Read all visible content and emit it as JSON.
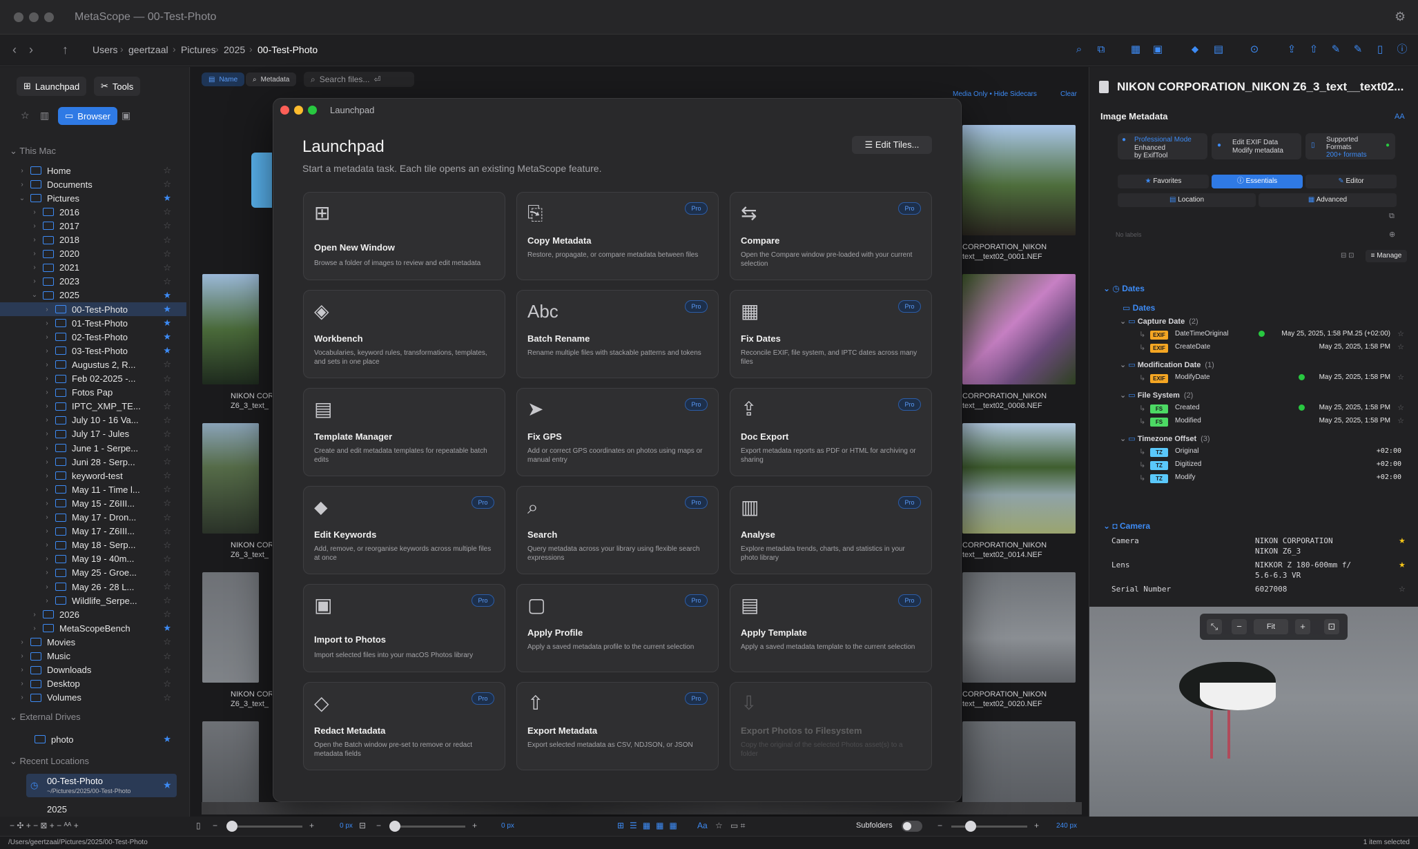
{
  "window": {
    "title": "MetaScope — 00-Test-Photo"
  },
  "breadcrumb": [
    "Users",
    "geertzaal",
    "Pictures",
    "2025",
    "00-Test-Photo"
  ],
  "sidebar": {
    "tabs": [
      "Launchpad",
      "Tools"
    ],
    "browser_label": "Browser",
    "this_mac_label": "This Mac",
    "external_label": "External Drives",
    "recent_label": "Recent Locations",
    "tree": [
      {
        "label": "Home",
        "level": 1,
        "star": false
      },
      {
        "label": "Documents",
        "level": 1,
        "star": false
      },
      {
        "label": "Pictures",
        "level": 1,
        "star": true,
        "open": true
      },
      {
        "label": "2016",
        "level": 2,
        "star": false
      },
      {
        "label": "2017",
        "level": 2,
        "star": false
      },
      {
        "label": "2018",
        "level": 2,
        "star": false
      },
      {
        "label": "2020",
        "level": 2,
        "star": false
      },
      {
        "label": "2021",
        "level": 2,
        "star": false
      },
      {
        "label": "2023",
        "level": 2,
        "star": false
      },
      {
        "label": "2025",
        "level": 2,
        "star": true,
        "open": true
      },
      {
        "label": "00-Test-Photo",
        "level": 3,
        "star": true,
        "selected": true
      },
      {
        "label": "01-Test-Photo",
        "level": 3,
        "star": true
      },
      {
        "label": "02-Test-Photo",
        "level": 3,
        "star": true
      },
      {
        "label": "03-Test-Photo",
        "level": 3,
        "star": true
      },
      {
        "label": "Augustus 2, R...",
        "level": 3,
        "star": false
      },
      {
        "label": "Feb 02-2025 -...",
        "level": 3,
        "star": false
      },
      {
        "label": "Fotos Pap",
        "level": 3,
        "star": false
      },
      {
        "label": "IPTC_XMP_TE...",
        "level": 3,
        "star": false
      },
      {
        "label": "July 10 - 16 Va...",
        "level": 3,
        "star": false
      },
      {
        "label": "July 17 - Jules",
        "level": 3,
        "star": false
      },
      {
        "label": "June 1 - Serpe...",
        "level": 3,
        "star": false
      },
      {
        "label": "Juni 28 - Serp...",
        "level": 3,
        "star": false
      },
      {
        "label": "keyword-test",
        "level": 3,
        "star": false
      },
      {
        "label": "May 11 - Time l...",
        "level": 3,
        "star": false
      },
      {
        "label": "May 15 - Z6III...",
        "level": 3,
        "star": false
      },
      {
        "label": "May 17 - Dron...",
        "level": 3,
        "star": false
      },
      {
        "label": "May 17 - Z6III...",
        "level": 3,
        "star": false
      },
      {
        "label": "May 18 - Serp...",
        "level": 3,
        "star": false
      },
      {
        "label": "May 19 - 40m...",
        "level": 3,
        "star": false
      },
      {
        "label": "May 25 - Groe...",
        "level": 3,
        "star": false
      },
      {
        "label": "May 26 - 28 L...",
        "level": 3,
        "star": false
      },
      {
        "label": "Wildlife_Serpe...",
        "level": 3,
        "star": false
      },
      {
        "label": "2026",
        "level": 2,
        "star": false
      },
      {
        "label": "MetaScopeBench",
        "level": 2,
        "star": true
      },
      {
        "label": "Movies",
        "level": 1,
        "star": false
      },
      {
        "label": "Music",
        "level": 1,
        "star": false
      },
      {
        "label": "Downloads",
        "level": 1,
        "star": false
      },
      {
        "label": "Desktop",
        "level": 1,
        "star": false
      },
      {
        "label": "Volumes",
        "level": 1,
        "star": false
      }
    ],
    "external": [
      {
        "label": "photo",
        "star": true
      }
    ],
    "recent": [
      {
        "label": "00-Test-Photo",
        "path": "~/Pictures/2025/00-Test-Photo"
      },
      {
        "label": "2025"
      }
    ]
  },
  "toolbar": {
    "name_tab": "Name",
    "metadata_tab": "Metadata",
    "search_placeholder": "Search files...",
    "media_only": "Media Only",
    "hide_sidecars": "Hide Sidecars",
    "clear": "Clear"
  },
  "thumbs_left": [
    {
      "l1": "NIKON COR",
      "l2": "Z6_3_text_"
    },
    {
      "l1": "NIKON COR",
      "l2": "Z6_3_text_"
    },
    {
      "l1": "NIKON COR",
      "l2": "Z6_3_text_"
    }
  ],
  "thumbs_right": [
    {
      "l1": "CORPORATION_NIKON",
      "l2": "text__text02_0001.NEF"
    },
    {
      "l1": "CORPORATION_NIKON",
      "l2": "text__text02_0008.NEF"
    },
    {
      "l1": "CORPORATION_NIKON",
      "l2": "text__text02_0014.NEF"
    },
    {
      "l1": "CORPORATION_NIKON",
      "l2": "text__text02_0020.NEF"
    }
  ],
  "launchpad": {
    "window_title": "Launchpad",
    "heading": "Launchpad",
    "subtitle": "Start a metadata task. Each tile opens an existing MetaScope feature.",
    "edit_tiles": "Edit Tiles...",
    "pro_label": "Pro",
    "tiles": [
      {
        "title": "Open New Window",
        "desc": "Browse a folder of images to review and edit metadata",
        "pro": false,
        "icon": "⊞"
      },
      {
        "title": "Copy Metadata",
        "desc": "Restore, propagate, or compare metadata between files",
        "pro": true,
        "icon": "⎘"
      },
      {
        "title": "Compare",
        "desc": "Open the Compare window pre-loaded with your current selection",
        "pro": true,
        "icon": "⇆"
      },
      {
        "title": "Workbench",
        "desc": "Vocabularies, keyword rules, transformations, templates, and sets in one place",
        "pro": false,
        "icon": "◈"
      },
      {
        "title": "Batch Rename",
        "desc": "Rename multiple files with stackable patterns and tokens",
        "pro": true,
        "icon": "Abc"
      },
      {
        "title": "Fix Dates",
        "desc": "Reconcile EXIF, file system, and IPTC dates across many files",
        "pro": true,
        "icon": "▦"
      },
      {
        "title": "Template Manager",
        "desc": "Create and edit metadata templates for repeatable batch edits",
        "pro": false,
        "icon": "▤"
      },
      {
        "title": "Fix GPS",
        "desc": "Add or correct GPS coordinates on photos using maps or manual entry",
        "pro": true,
        "icon": "➤"
      },
      {
        "title": "Doc Export",
        "desc": "Export metadata reports as PDF or HTML for archiving or sharing",
        "pro": true,
        "icon": "⇪"
      },
      {
        "title": "Edit Keywords",
        "desc": "Add, remove, or reorganise keywords across multiple files at once",
        "pro": true,
        "icon": "⬥"
      },
      {
        "title": "Search",
        "desc": "Query metadata across your library using flexible search expressions",
        "pro": true,
        "icon": "⌕"
      },
      {
        "title": "Analyse",
        "desc": "Explore metadata trends, charts, and statistics in your photo library",
        "pro": true,
        "icon": "▥"
      },
      {
        "title": "Import to Photos",
        "desc": "Import selected files into your macOS Photos library",
        "pro": true,
        "icon": "▣"
      },
      {
        "title": "Apply Profile",
        "desc": "Apply a saved metadata profile to the current selection",
        "pro": true,
        "icon": "▢"
      },
      {
        "title": "Apply Template",
        "desc": "Apply a saved metadata template to the current selection",
        "pro": true,
        "icon": "▤"
      },
      {
        "title": "Redact Metadata",
        "desc": "Open the Batch window pre-set to remove or redact metadata fields",
        "pro": true,
        "icon": "◇"
      },
      {
        "title": "Export Metadata",
        "desc": "Export selected metadata as CSV, NDJSON, or JSON",
        "pro": true,
        "icon": "⇧"
      },
      {
        "title": "Export Photos to Filesystem",
        "desc": "Copy the original of the selected Photos asset(s) to a folder",
        "pro": false,
        "icon": "⇩",
        "disabled": true
      }
    ]
  },
  "inspector": {
    "title": "NIKON CORPORATION_NIKON Z6_3_text__text02...",
    "section_title": "Image Metadata",
    "aa": "AA",
    "pro_mode": {
      "l1": "Professional Mode",
      "l2": "Enhanced",
      "l3": "by ExifTool"
    },
    "edit_exif": {
      "l1": "Edit EXIF Data",
      "l2": "Modify metadata"
    },
    "formats": {
      "l1": "Supported",
      "l2": "Formats",
      "l3": "200+ formats"
    },
    "tabs": [
      "Favorites",
      "Essentials",
      "Editor",
      "Location",
      "Advanced"
    ],
    "no_labels": "No labels",
    "manage": "Manage",
    "dates_header": "Dates",
    "dates_sub": "Dates",
    "groups": [
      {
        "name": "Capture Date",
        "count": "(2)",
        "rows": [
          {
            "badge": "EXIF",
            "key": "DateTimeOriginal",
            "value": "May 25, 2025, 1:58 PM.25 (+02:00)",
            "check": true
          },
          {
            "badge": "EXIF",
            "key": "CreateDate",
            "value": "May 25, 2025, 1:58 PM",
            "check": false
          }
        ]
      },
      {
        "name": "Modification Date",
        "count": "(1)",
        "rows": [
          {
            "badge": "EXIF",
            "key": "ModifyDate",
            "value": "May 25, 2025, 1:58 PM",
            "check": true
          }
        ]
      },
      {
        "name": "File System",
        "count": "(2)",
        "rows": [
          {
            "badge": "FS",
            "key": "Created",
            "value": "May 25, 2025, 1:58 PM",
            "check": true
          },
          {
            "badge": "FS",
            "key": "Modified",
            "value": "May 25, 2025, 1:58 PM",
            "check": false
          }
        ]
      },
      {
        "name": "Timezone Offset",
        "count": "(3)",
        "rows": [
          {
            "badge": "TZ",
            "key": "Original",
            "value": "+02:00",
            "check": false
          },
          {
            "badge": "TZ",
            "key": "Digitized",
            "value": "+02:00",
            "check": false
          },
          {
            "badge": "TZ",
            "key": "Modify",
            "value": "+02:00",
            "check": false
          }
        ]
      }
    ],
    "camera_header": "Camera",
    "camera_rows": [
      {
        "key": "Camera",
        "value": "NIKON CORPORATION",
        "value2": "NIKON Z6_3",
        "star": true
      },
      {
        "key": "Lens",
        "value": "NIKKOR Z 180-600mm f/",
        "value2": "5.6-6.3 VR",
        "star": true
      },
      {
        "key": "Serial Number",
        "value": "6027008",
        "star": false
      }
    ],
    "preview": {
      "fit": "Fit"
    }
  },
  "bottom": {
    "px1": "0 px",
    "px2": "0 px",
    "subfolders": "Subfolders",
    "size": "240 px"
  },
  "status": {
    "path": "/Users/geertzaal/Pictures/2025/00-Test-Photo",
    "selection": "1 item selected"
  },
  "colors": {
    "accent": "#3d8bf5",
    "exif": "#f5a623",
    "fs": "#4cd964",
    "tz": "#5ac8fa"
  }
}
